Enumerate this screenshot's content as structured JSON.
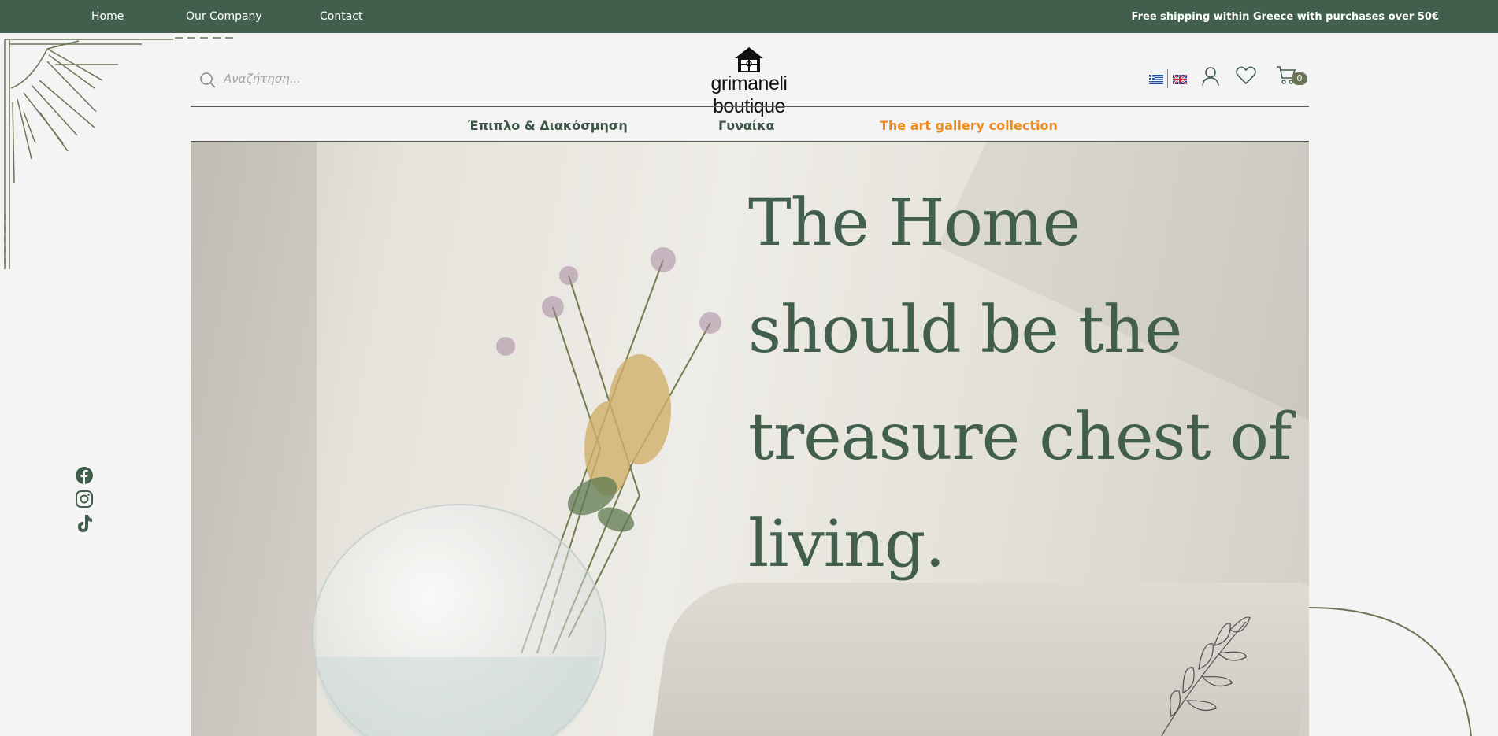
{
  "topbar": {
    "nav": [
      {
        "label": "Home"
      },
      {
        "label": "Our Company"
      },
      {
        "label": "Contact"
      }
    ],
    "shipping_notice": "Free shipping within Greece with purchases over 50€"
  },
  "header": {
    "search_placeholder": "Αναζήτηση...",
    "logo_text": "grimaneli boutique",
    "languages": [
      "greek-flag",
      "uk-flag"
    ],
    "cart_count": "0"
  },
  "categories": [
    {
      "label": "Έπιπλο & Διακόσμηση"
    },
    {
      "label": "Γυναίκα"
    },
    {
      "label": "The art gallery collection",
      "color": "#ef8a1e"
    }
  ],
  "hero": {
    "line1": "The Home",
    "line2": "should be the",
    "line3": "treasure chest of",
    "line4": "living."
  },
  "social": [
    "facebook-icon",
    "instagram-icon",
    "tiktok-icon"
  ],
  "colors": {
    "brand_green": "#425e4c",
    "accent_orange": "#ef8a1e",
    "background": "#f4f4f4"
  }
}
